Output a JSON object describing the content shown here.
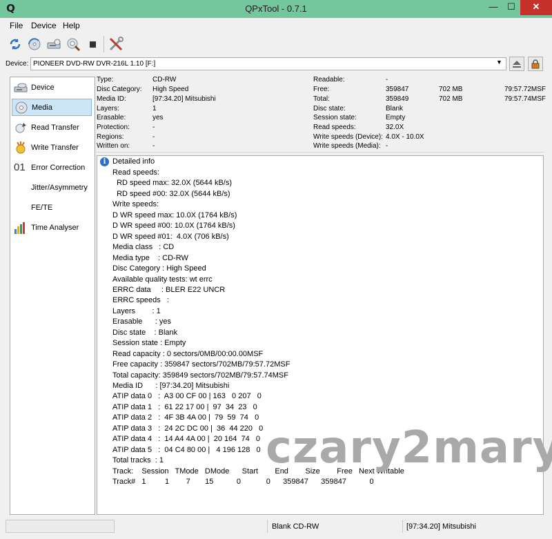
{
  "window": {
    "title": "QPxTool - 0.7.1",
    "app_icon": "Q",
    "min": "—",
    "max": "☐",
    "close": "✕"
  },
  "menu": [
    "File",
    "Device",
    "Help"
  ],
  "device": {
    "label": "Device:",
    "value": "PIONEER  DVD-RW  DVR-216L 1.10 [F:]"
  },
  "sidebar": [
    {
      "label": "Device",
      "icon": "drive-icon"
    },
    {
      "label": "Media",
      "icon": "disc-icon"
    },
    {
      "label": "Read Transfer",
      "icon": "read-transfer-icon"
    },
    {
      "label": "Write Transfer",
      "icon": "write-transfer-icon"
    },
    {
      "label": "Error Correction",
      "icon_text": "01"
    },
    {
      "label": "Jitter/Asymmetry"
    },
    {
      "label": "FE/TE"
    },
    {
      "label": "Time Analyser",
      "icon": "bar-chart-icon"
    }
  ],
  "info_left": [
    {
      "k": "Type:",
      "v": "CD-RW"
    },
    {
      "k": "Disc Category:",
      "v": "High Speed"
    },
    {
      "k": "Media ID:",
      "v": "[97:34.20] Mitsubishi"
    },
    {
      "k": "Layers:",
      "v": "1"
    },
    {
      "k": "Erasable:",
      "v": "yes"
    },
    {
      "k": "Protection:",
      "v": "-"
    },
    {
      "k": "Regions:",
      "v": "-"
    },
    {
      "k": "Written on:",
      "v": "-"
    }
  ],
  "info_right": [
    {
      "k": "Readable:",
      "v": "-",
      "mb": "",
      "msf": ""
    },
    {
      "k": "Free:",
      "v": "359847",
      "mb": "702 MB",
      "msf": "79:57.72MSF"
    },
    {
      "k": "Total:",
      "v": "359849",
      "mb": "702 MB",
      "msf": "79:57.74MSF"
    },
    {
      "k": "Disc state:",
      "v": "Blank",
      "mb": "",
      "msf": ""
    },
    {
      "k": "Session state:",
      "v": "Empty",
      "mb": "",
      "msf": ""
    },
    {
      "k": "Read speeds:",
      "v": "32.0X",
      "mb": "",
      "msf": ""
    },
    {
      "k": "Write speeds (Device):",
      "v": "4.0X - 10.0X",
      "mb": "",
      "msf": ""
    },
    {
      "k": "Write speeds (Media):",
      "v": "-",
      "mb": "",
      "msf": ""
    }
  ],
  "detail": {
    "header": "Detailed info",
    "lines": [
      "Read speeds:",
      "  RD speed max: 32.0X (5644 kB/s)",
      "  RD speed #00: 32.0X (5644 kB/s)",
      "Write speeds:",
      "D WR speed max: 10.0X (1764 kB/s)",
      "D WR speed #00: 10.0X (1764 kB/s)",
      "D WR speed #01:  4.0X (706 kB/s)",
      "Media class   : CD",
      "Media type    : CD-RW",
      "Disc Category : High Speed",
      "Available quality tests: wt errc",
      "ERRC data     : BLER E22 UNCR",
      "ERRC speeds   :",
      "Layers        : 1",
      "Erasable      : yes",
      "Disc state    : Blank",
      "Session state : Empty",
      "Read capacity : 0 sectors/0MB/00:00.00MSF",
      "Free capacity : 359847 sectors/702MB/79:57.72MSF",
      "Total capacity: 359849 sectors/702MB/79:57.74MSF",
      "Media ID      : [97:34.20] Mitsubishi",
      "ATIP data 0   :  A3 00 CF 00 | 163   0 207   0",
      "ATIP data 1   :  61 22 17 00 |  97  34  23   0",
      "ATIP data 2   :  4F 3B 4A 00 |  79  59  74   0",
      "ATIP data 3   :  24 2C DC 00 |  36  44 220   0",
      "ATIP data 4   :  14 A4 4A 00 |  20 164  74   0",
      "ATIP data 5   :  04 C4 80 00 |   4 196 128   0",
      "Total tracks  : 1",
      "Track:    Session   TMode   DMode      Start        End        Size        Free   Next Writable",
      "Track#   1         1        7       15           0            0      359847      359847           0"
    ]
  },
  "watermark": "czary2mary",
  "status": {
    "left": "",
    "middle": "Blank CD-RW",
    "right": "[97:34.20] Mitsubishi"
  }
}
